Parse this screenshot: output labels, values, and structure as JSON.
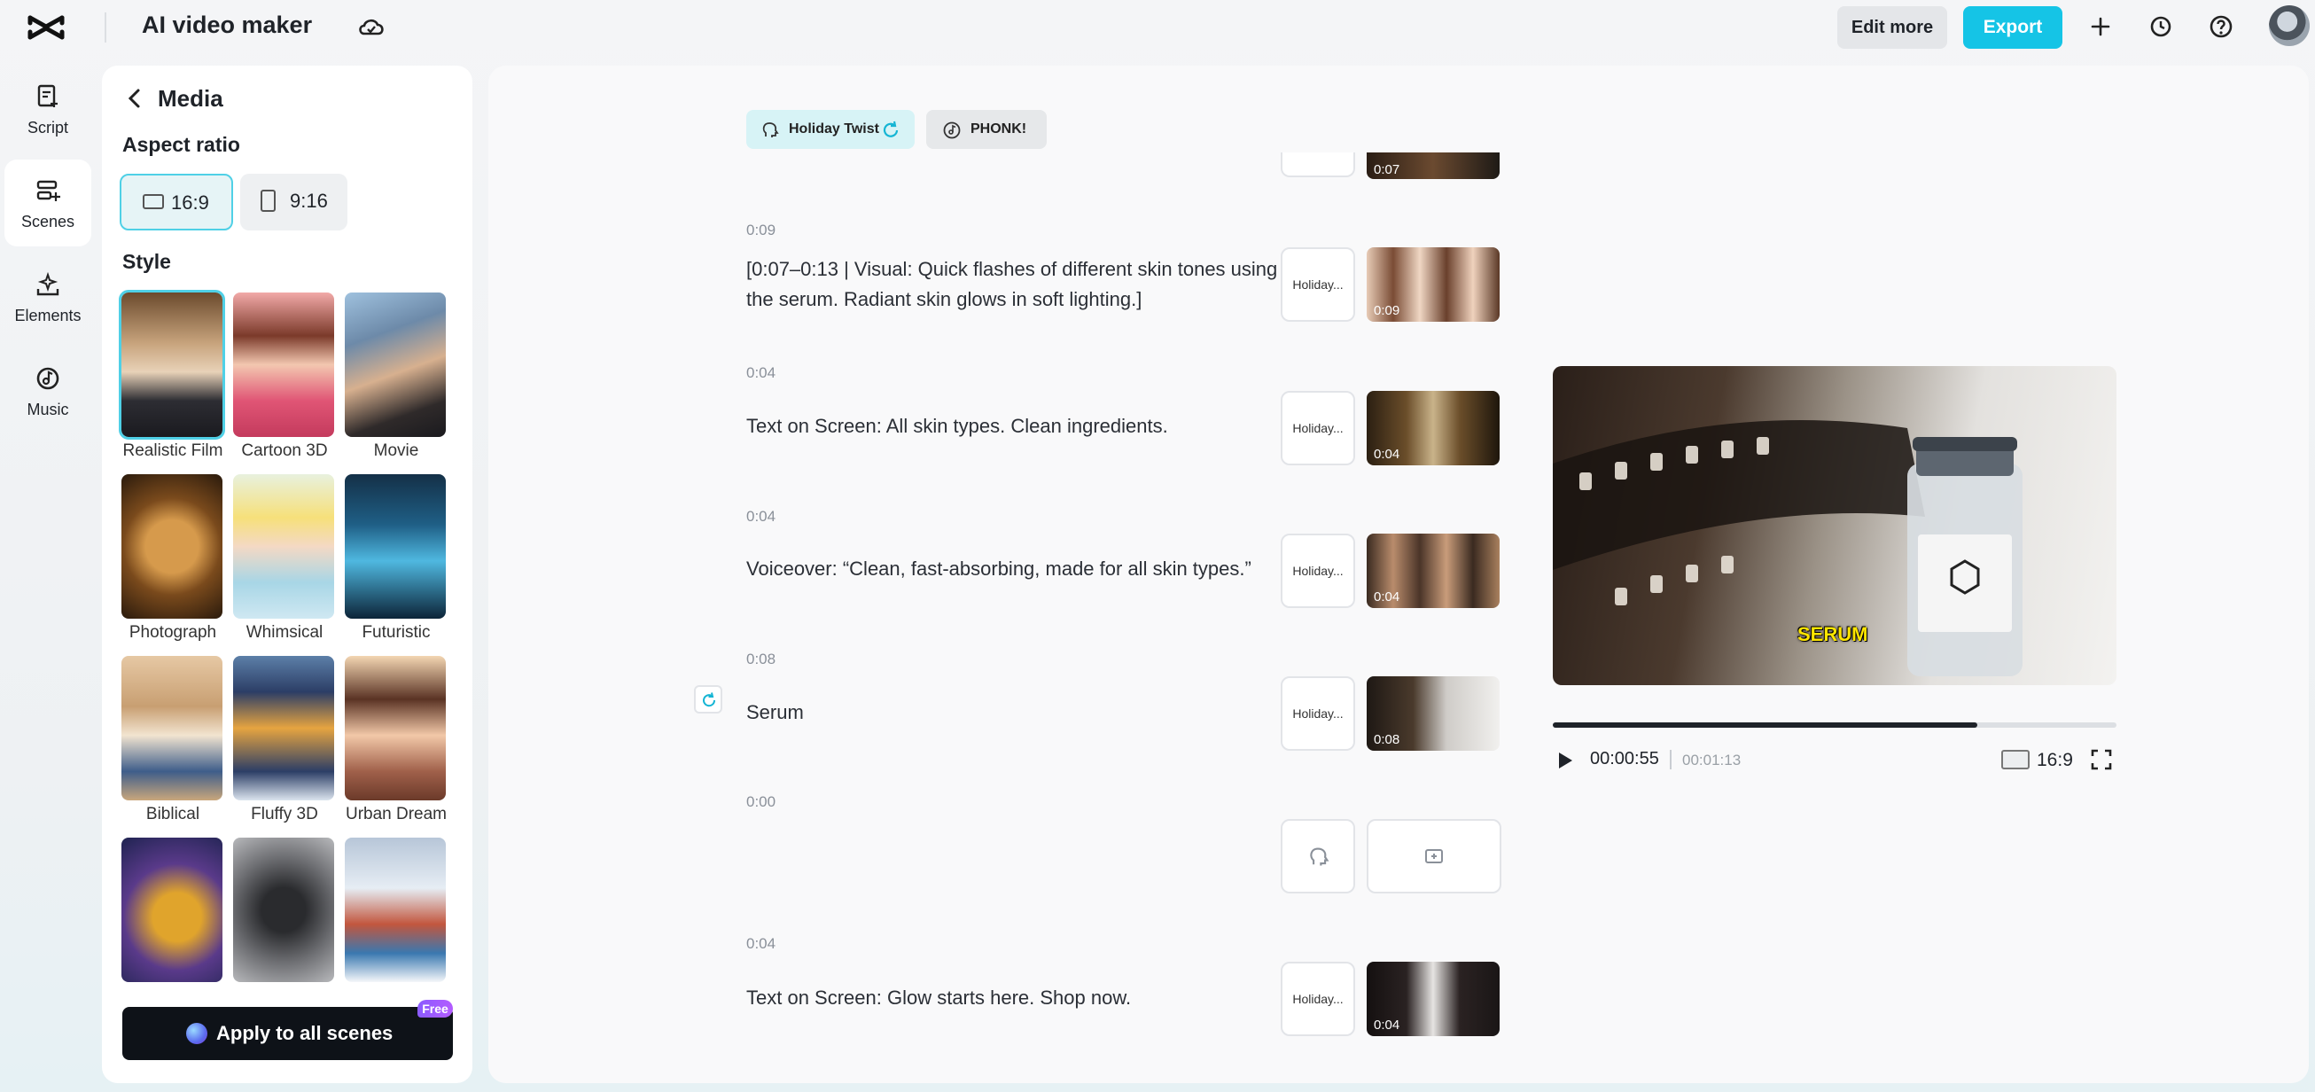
{
  "header": {
    "app_title": "AI video maker",
    "edit_more_label": "Edit more",
    "export_label": "Export"
  },
  "rail": {
    "items": [
      {
        "label": "Script",
        "icon": "script-icon"
      },
      {
        "label": "Scenes",
        "icon": "scenes-icon",
        "active": true
      },
      {
        "label": "Elements",
        "icon": "elements-icon"
      },
      {
        "label": "Music",
        "icon": "music-icon"
      }
    ]
  },
  "panel": {
    "title": "Media",
    "aspect_ratio_title": "Aspect ratio",
    "aspect_options": [
      "16:9",
      "9:16"
    ],
    "selected_aspect": "16:9",
    "style_title": "Style",
    "styles": [
      "Realistic Film",
      "Cartoon 3D",
      "Movie",
      "Photograph",
      "Whimsical",
      "Futuristic",
      "Biblical",
      "Fluffy 3D",
      "Urban Dream",
      "",
      "",
      ""
    ],
    "selected_style": "Realistic Film",
    "apply_label": "Apply to all scenes",
    "free_badge": "Free"
  },
  "main": {
    "voice_pill": "Holiday Twist",
    "music_pill": "PHONK!",
    "scenes": [
      {
        "time": "0:09",
        "text": "[0:07–0:13 | Visual: Quick flashes of different skin tones using the serum. Radiant skin glows in soft lighting.]",
        "voice": "Holiday...",
        "clip_duration": "0:09"
      },
      {
        "time": "0:04",
        "text": "Text on Screen: All skin types. Clean ingredients.",
        "voice": "Holiday...",
        "clip_duration": "0:04"
      },
      {
        "time": "0:04",
        "text": "Voiceover: “Clean, fast-absorbing, made for all skin types.”",
        "voice": "Holiday...",
        "clip_duration": "0:04"
      },
      {
        "time": "0:08",
        "text": "Serum",
        "voice": "Holiday...",
        "clip_duration": "0:08"
      },
      {
        "time": "0:00",
        "text": "",
        "voice": "",
        "clip_duration": ""
      },
      {
        "time": "0:04",
        "text": "Text on Screen: Glow starts here. Shop now.",
        "voice": "Holiday...",
        "clip_duration": "0:04"
      }
    ],
    "partial_top_clip_duration": "0:07"
  },
  "preview": {
    "caption": "SERUM",
    "current_time": "00:00:55",
    "total_time": "00:01:13",
    "progress": 0.753,
    "ratio_label": "16:9",
    "accent_color": "#15c4e6"
  }
}
